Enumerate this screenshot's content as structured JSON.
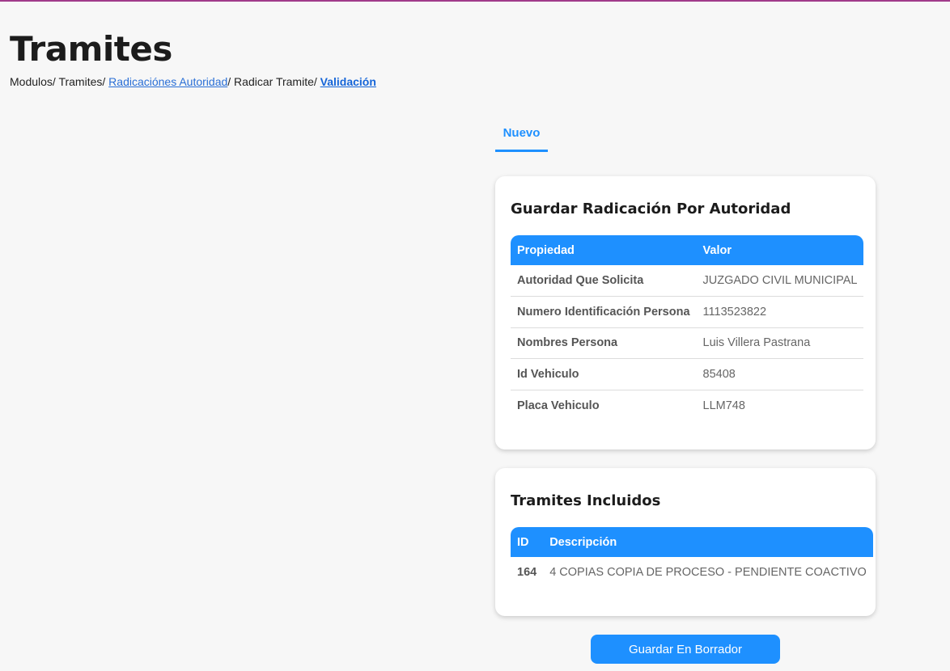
{
  "page": {
    "title": "Tramites"
  },
  "breadcrumb": {
    "items": [
      {
        "label": "Modulos/ "
      },
      {
        "label": "Tramites/ "
      },
      {
        "label": "Radicaciónes Autoridad"
      },
      {
        "label": "/ Radicar Tramite/ "
      },
      {
        "label": "Validación"
      }
    ]
  },
  "tabs": [
    {
      "label": "Nuevo"
    }
  ],
  "radicacion_card": {
    "title": "Guardar Radicación Por Autoridad",
    "headers": [
      "Propiedad",
      "Valor"
    ],
    "rows": [
      {
        "key": "Autoridad Que Solicita",
        "value": "JUZGADO CIVIL MUNICIPAL"
      },
      {
        "key": "Numero Identificación Persona",
        "value": "1113523822"
      },
      {
        "key": "Nombres Persona",
        "value": "Luis Villera Pastrana"
      },
      {
        "key": "Id Vehiculo",
        "value": "85408"
      },
      {
        "key": "Placa Vehiculo",
        "value": "LLM748"
      }
    ]
  },
  "tramites_card": {
    "title": "Tramites Incluidos",
    "headers": [
      "ID",
      "Descripción"
    ],
    "rows": [
      {
        "id": "164",
        "descripcion": "4 COPIAS COPIA DE PROCESO - PENDIENTE COACTIVO"
      }
    ]
  },
  "actions": {
    "save_draft_label": "Guardar En Borrador"
  },
  "colors": {
    "accent": "#1e90ff",
    "link": "#2a6fd6",
    "top_strip": "#a03a8a",
    "background": "#f7f7f7"
  }
}
